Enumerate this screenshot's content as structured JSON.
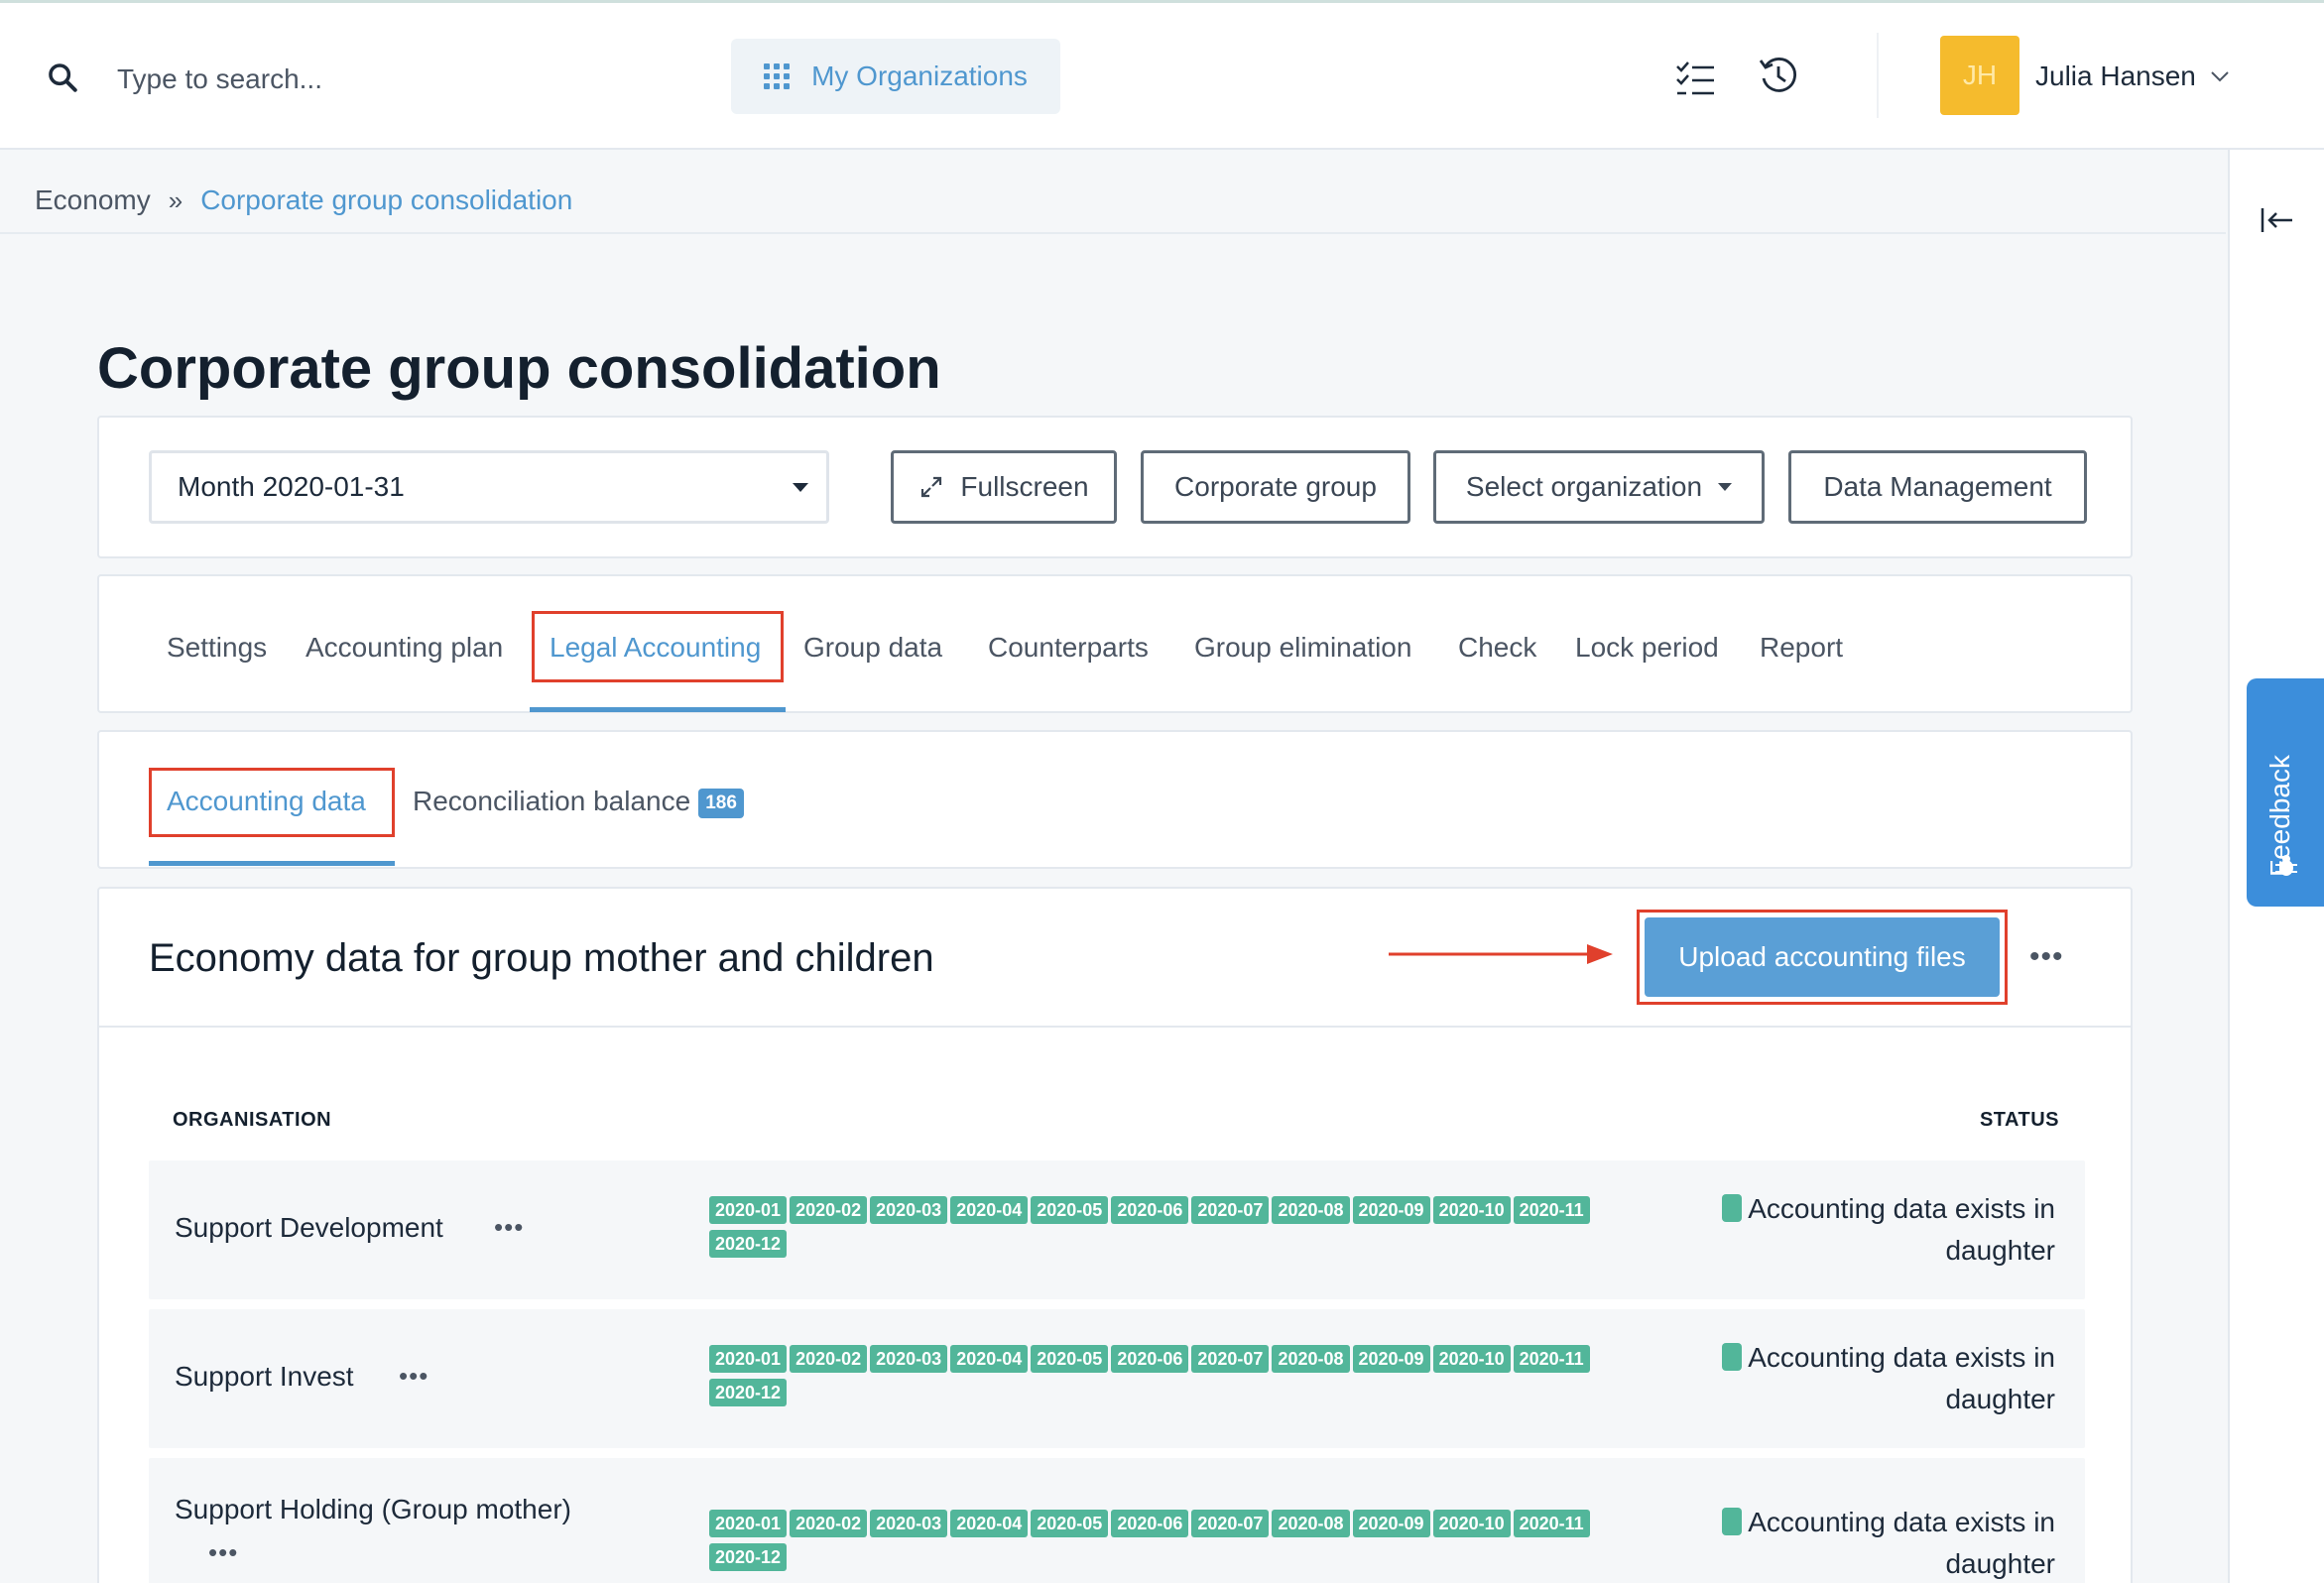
{
  "header": {
    "search_placeholder": "Type to search...",
    "org_button_label": "My Organizations",
    "user_initials": "JH",
    "user_name": "Julia Hansen"
  },
  "breadcrumb": {
    "home": "Economy",
    "separator": "»",
    "current": "Corporate group consolidation"
  },
  "page_title": "Corporate group consolidation",
  "toolbar": {
    "period_select": "Month 2020-01-31",
    "fullscreen": "Fullscreen",
    "corporate_group": "Corporate group",
    "select_organization": "Select organization",
    "data_management": "Data Management"
  },
  "tabs": [
    {
      "label": "Settings"
    },
    {
      "label": "Accounting plan"
    },
    {
      "label": "Legal Accounting",
      "active": true
    },
    {
      "label": "Group data"
    },
    {
      "label": "Counterparts"
    },
    {
      "label": "Group elimination"
    },
    {
      "label": "Check"
    },
    {
      "label": "Lock period"
    },
    {
      "label": "Report"
    }
  ],
  "subtabs": {
    "accounting_data": "Accounting data",
    "reconciliation_balance": "Reconciliation balance",
    "reconciliation_count": "186"
  },
  "section": {
    "title": "Economy data for group mother and children",
    "upload_button": "Upload accounting files",
    "more": "•••"
  },
  "table": {
    "col_organisation": "ORGANISATION",
    "col_status": "STATUS",
    "rows": [
      {
        "name": "Support Development",
        "periods": [
          "2020-01",
          "2020-02",
          "2020-03",
          "2020-04",
          "2020-05",
          "2020-06",
          "2020-07",
          "2020-08",
          "2020-09",
          "2020-10",
          "2020-11",
          "2020-12"
        ],
        "status": "Accounting data exists in daughter"
      },
      {
        "name": "Support Invest",
        "periods": [
          "2020-01",
          "2020-02",
          "2020-03",
          "2020-04",
          "2020-05",
          "2020-06",
          "2020-07",
          "2020-08",
          "2020-09",
          "2020-10",
          "2020-11",
          "2020-12"
        ],
        "status": "Accounting data exists in daughter"
      },
      {
        "name": "Support Holding (Group mother)",
        "periods": [
          "2020-01",
          "2020-02",
          "2020-03",
          "2020-04",
          "2020-05",
          "2020-06",
          "2020-07",
          "2020-08",
          "2020-09",
          "2020-10",
          "2020-11",
          "2020-12"
        ],
        "status": "Accounting data exists in daughter"
      }
    ]
  },
  "feedback_label": "Feedback",
  "colors": {
    "accent": "#4f97cf",
    "period_chip": "#52b69a",
    "highlight_box": "#e0402c",
    "avatar": "#f5bb2d",
    "feedback": "#3c8edb"
  }
}
